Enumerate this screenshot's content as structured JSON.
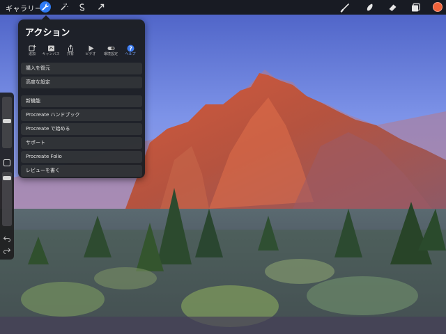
{
  "toolbar": {
    "gallery_label": "ギャラリー",
    "left_tools": [
      "wrench-icon",
      "magic-wand-icon",
      "selection-icon",
      "transform-arrow-icon"
    ],
    "right_tools": [
      "brush-icon",
      "smudge-icon",
      "eraser-icon",
      "layers-icon"
    ],
    "current_color": "#f0623a",
    "accent": "#2f7bf5"
  },
  "actions_panel": {
    "title": "アクション",
    "tabs": [
      {
        "label": "追加",
        "icon": "add-image-icon"
      },
      {
        "label": "キャンバス",
        "icon": "canvas-icon"
      },
      {
        "label": "共有",
        "icon": "share-icon"
      },
      {
        "label": "ビデオ",
        "icon": "video-play-icon"
      },
      {
        "label": "環境設定",
        "icon": "toggle-icon"
      },
      {
        "label": "ヘルプ",
        "icon": "help-icon"
      }
    ],
    "selected_tab": "ヘルプ",
    "group1": [
      "購入を復元",
      "高度な設定"
    ],
    "group2": [
      "新機能",
      "Procreate ハンドブック",
      "Procreate で始める",
      "サポート",
      "Procreate Folio",
      "レビューを書く"
    ]
  }
}
